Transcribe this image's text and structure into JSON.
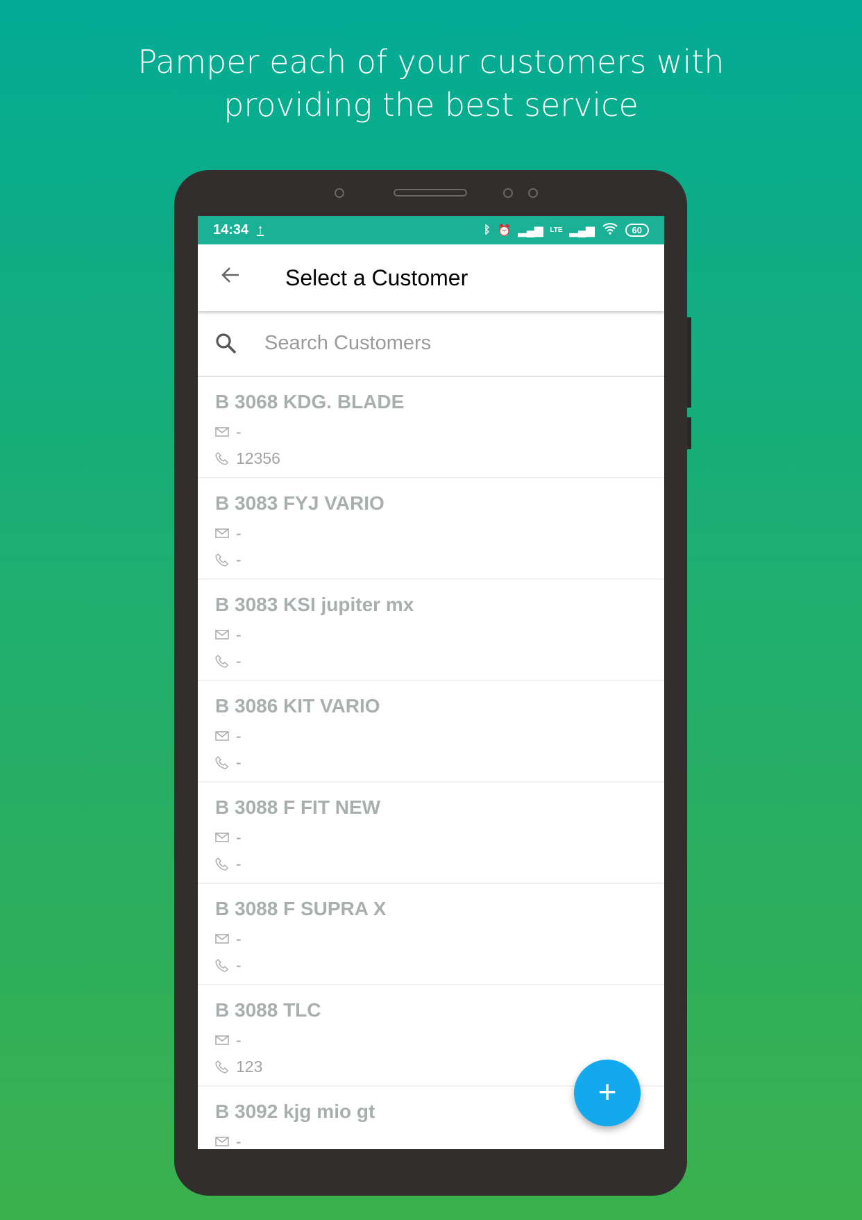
{
  "headline": {
    "line1": "Pamper each of your customers with",
    "line2": "providing the best service"
  },
  "status_bar": {
    "time": "14:34",
    "battery": "60",
    "lte": "LTE"
  },
  "app_bar": {
    "title": "Select a Customer"
  },
  "search": {
    "placeholder": "Search Customers",
    "value": ""
  },
  "customers": [
    {
      "name": "B 3068 KDG. BLADE",
      "email": "-",
      "phone": "12356"
    },
    {
      "name": "B 3083 FYJ VARIO",
      "email": "-",
      "phone": "-"
    },
    {
      "name": "B 3083 KSI jupiter mx",
      "email": "-",
      "phone": "-"
    },
    {
      "name": "B 3086 KIT VARIO",
      "email": "-",
      "phone": "-"
    },
    {
      "name": "B 3088 F FIT NEW",
      "email": "-",
      "phone": "-"
    },
    {
      "name": "B 3088 F SUPRA X",
      "email": "-",
      "phone": "-"
    },
    {
      "name": "B 3088 TLC",
      "email": "-",
      "phone": "123"
    },
    {
      "name": "B 3092 kjg mio gt",
      "email": "-",
      "phone": ""
    }
  ],
  "fab": {
    "label": "+"
  },
  "colors": {
    "status_bar": "#1ab196",
    "fab": "#14a8ed",
    "customer_name": "#a8afae"
  }
}
